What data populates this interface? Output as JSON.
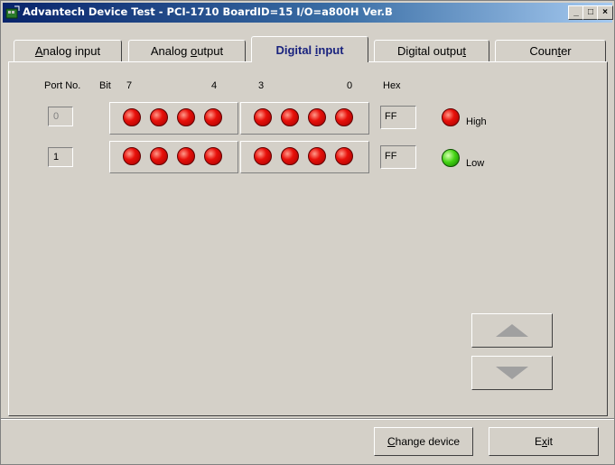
{
  "window": {
    "title": "Advantech Device Test - PCI-1710 BoardID=15 I/O=a800H Ver.B",
    "controls": {
      "minimize": "_",
      "maximize": "□",
      "close": "×"
    }
  },
  "tabs": [
    {
      "label_pre": "",
      "label_u": "A",
      "label_post": "nalog input",
      "active": false
    },
    {
      "label_pre": "Analog ",
      "label_u": "o",
      "label_post": "utput",
      "active": false
    },
    {
      "label_pre": "Digital ",
      "label_u": "i",
      "label_post": "nput",
      "active": true
    },
    {
      "label_pre": "Digital outpu",
      "label_u": "t",
      "label_post": "",
      "active": false
    },
    {
      "label_pre": "Coun",
      "label_u": "t",
      "label_post": "er",
      "active": false
    }
  ],
  "headers": {
    "port_no": "Port No.",
    "bit": "Bit",
    "bit7": "7",
    "bit4": "4",
    "bit3": "3",
    "bit0": "0",
    "hex": "Hex"
  },
  "ports": [
    {
      "number": "0",
      "hex": "FF",
      "bits": [
        "high",
        "high",
        "high",
        "high",
        "high",
        "high",
        "high",
        "high"
      ]
    },
    {
      "number": "1",
      "hex": "FF",
      "bits": [
        "high",
        "high",
        "high",
        "high",
        "high",
        "high",
        "high",
        "high"
      ]
    }
  ],
  "legend": {
    "high_label": "High",
    "low_label": "Low",
    "high_color": "#e8100a",
    "low_color": "#44d414"
  },
  "buttons": {
    "change_device_pre": "",
    "change_device_u": "C",
    "change_device_post": "hange device",
    "exit_pre": "E",
    "exit_u": "x",
    "exit_post": "it"
  },
  "icons": {
    "up": "triangle-up-icon",
    "down": "triangle-down-icon",
    "app": "device-test-app-icon"
  }
}
